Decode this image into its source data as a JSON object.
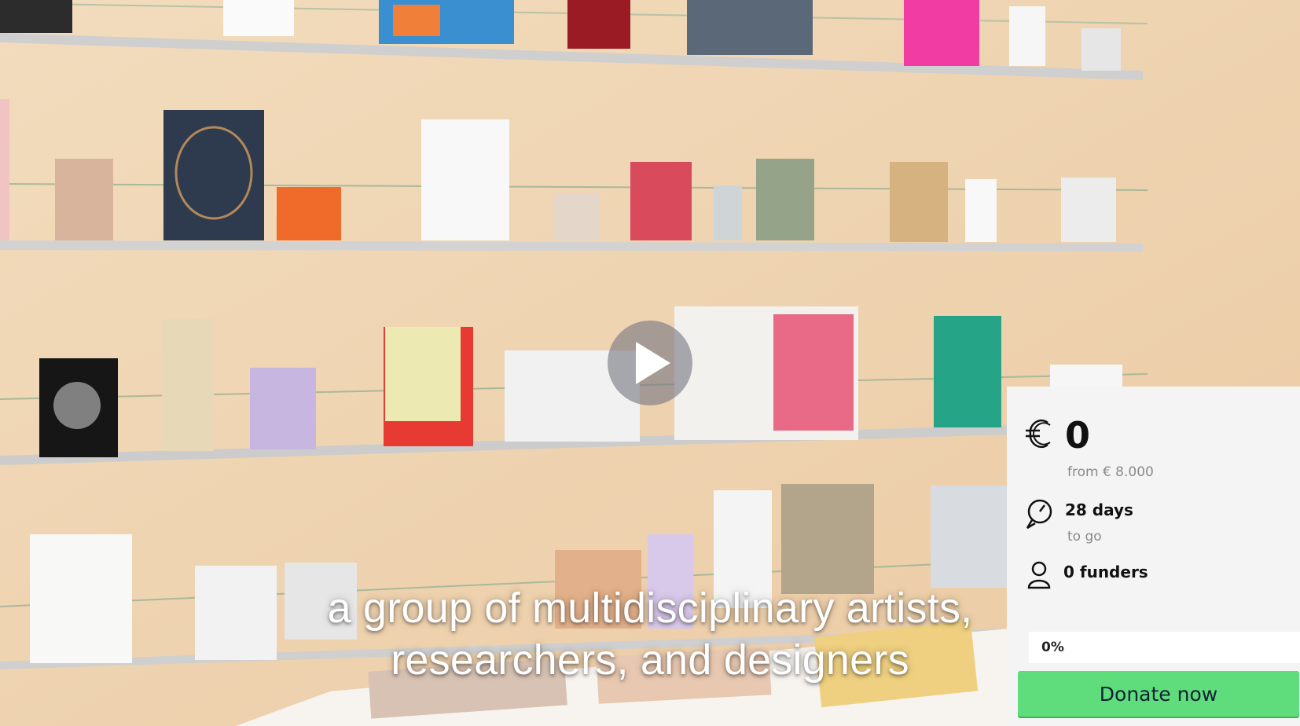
{
  "video": {
    "subtitle_line1": "a group of multidisciplinary artists,",
    "subtitle_line2": "researchers, and designers"
  },
  "icons": {
    "play": "play-icon",
    "currency": "euro-icon",
    "time": "clock-icon",
    "funders": "user-icon"
  },
  "funding": {
    "amount": "0",
    "target": "from € 8.000",
    "days_value": "28 days",
    "days_label": "to go",
    "funders": "0 funders",
    "progress_label": "0%",
    "progress_fraction": 0.0,
    "donate_label": "Donate now"
  },
  "colors": {
    "accent_green": "#5fdc7c",
    "panel_bg": "#f4f4f4"
  }
}
